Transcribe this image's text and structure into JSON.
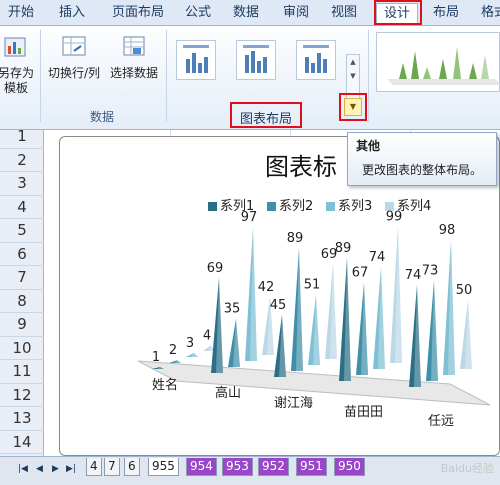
{
  "ribbon_tabs": [
    "开始",
    "插入",
    "页面布局",
    "公式",
    "数据",
    "审阅",
    "视图",
    "设计",
    "布局",
    "格式"
  ],
  "active_tab": "设计",
  "ribbon": {
    "save_template": "另存为\n模板",
    "switch_row_col": "切换行/列",
    "select_data": "选择数据",
    "group_data_label": "数据",
    "group_chart_layout_label": "图表布局"
  },
  "tooltip": {
    "title": "其他",
    "description": "更改图表的整体布局。"
  },
  "row_numbers": [
    "1",
    "2",
    "3",
    "4",
    "5",
    "6",
    "7",
    "8",
    "9",
    "10",
    "11",
    "12",
    "13",
    "14"
  ],
  "chart_data": {
    "type": "bar",
    "title": "图表标",
    "categories": [
      "姓名",
      "高山",
      "谢江海",
      "苗田田",
      "任远"
    ],
    "series": [
      {
        "name": "系列1",
        "values": [
          1,
          69,
          45,
          89,
          74
        ]
      },
      {
        "name": "系列2",
        "values": [
          2,
          35,
          89,
          67,
          73
        ]
      },
      {
        "name": "系列3",
        "values": [
          3,
          97,
          51,
          74,
          98
        ]
      },
      {
        "name": "系列4",
        "values": [
          4,
          42,
          69,
          99,
          50
        ]
      }
    ],
    "colors": [
      "#2a6f86",
      "#3f8fa8",
      "#7fc0d4",
      "#bcd8e6"
    ]
  },
  "sheet_tabs": [
    "4",
    "7",
    "6",
    "955",
    "954",
    "953",
    "952",
    "951",
    "950"
  ],
  "active_sheet": "955",
  "watermark": "Baidu经验"
}
